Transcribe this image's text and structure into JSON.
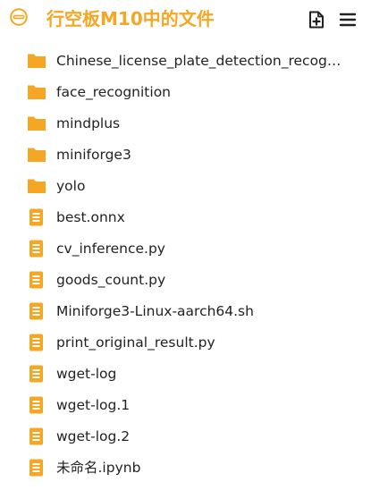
{
  "colors": {
    "accent": "#F5A623",
    "text": "#222222"
  },
  "header": {
    "title": "行空板M10中的文件",
    "logo_icon": "logo-ring-icon",
    "new_file_icon": "new-file-icon",
    "menu_icon": "hamburger-menu-icon"
  },
  "files": [
    {
      "name": "Chinese_license_plate_detection_recogniti…",
      "type": "folder"
    },
    {
      "name": "face_recognition",
      "type": "folder"
    },
    {
      "name": "mindplus",
      "type": "folder"
    },
    {
      "name": "miniforge3",
      "type": "folder"
    },
    {
      "name": "yolo",
      "type": "folder"
    },
    {
      "name": "best.onnx",
      "type": "file"
    },
    {
      "name": "cv_inference.py",
      "type": "file"
    },
    {
      "name": "goods_count.py",
      "type": "file"
    },
    {
      "name": "Miniforge3-Linux-aarch64.sh",
      "type": "file"
    },
    {
      "name": "print_original_result.py",
      "type": "file"
    },
    {
      "name": "wget-log",
      "type": "file"
    },
    {
      "name": "wget-log.1",
      "type": "file"
    },
    {
      "name": "wget-log.2",
      "type": "file"
    },
    {
      "name": "未命名.ipynb",
      "type": "file"
    }
  ]
}
